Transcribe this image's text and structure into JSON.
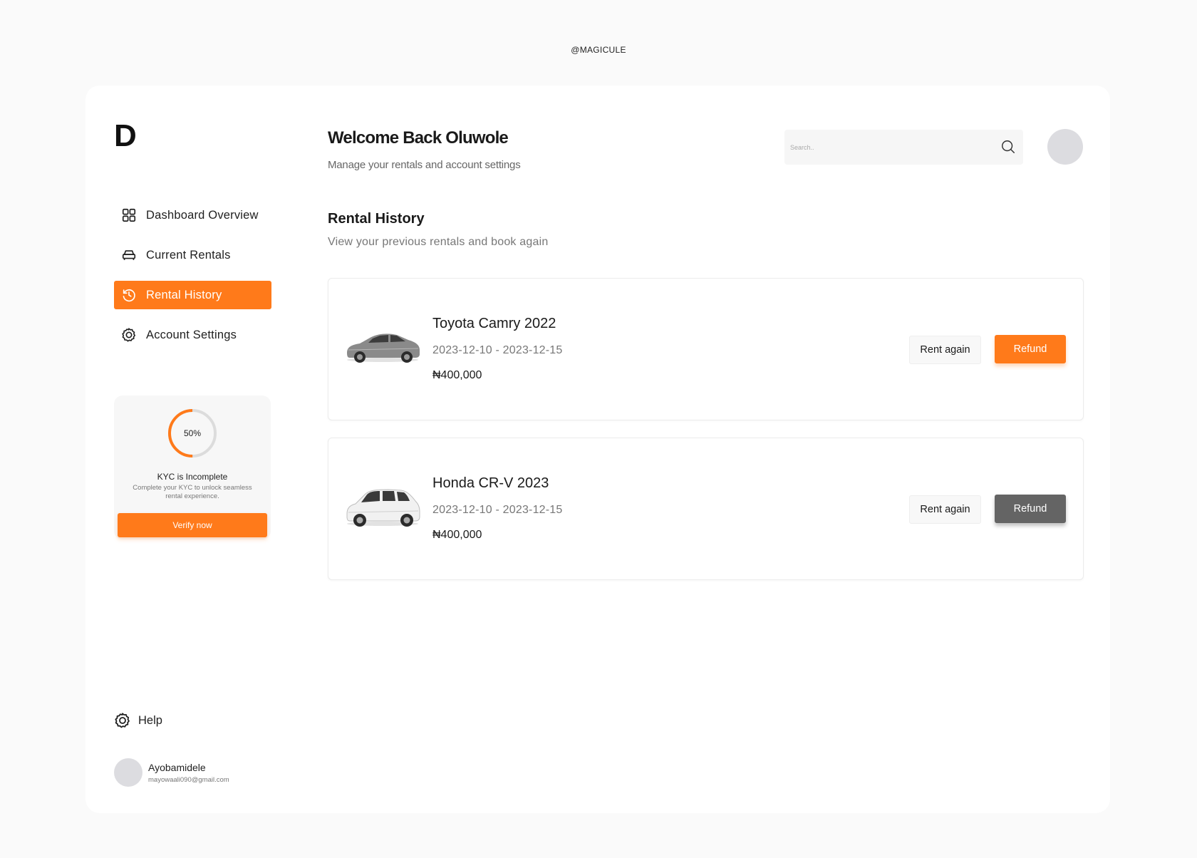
{
  "watermark": "@MAGICULE",
  "brand": {
    "logo": "D",
    "accent": "#ff7a1a"
  },
  "sidebar": {
    "items": [
      {
        "label": "Dashboard Overview",
        "icon": "grid-icon",
        "active": false
      },
      {
        "label": "Current Rentals",
        "icon": "car-icon",
        "active": false
      },
      {
        "label": "Rental History",
        "icon": "history-icon",
        "active": true
      },
      {
        "label": "Account Settings",
        "icon": "gear-icon",
        "active": false
      }
    ],
    "help_label": "Help"
  },
  "kyc": {
    "progress_percent": 50,
    "progress_label": "50%",
    "title": "KYC is Incomplete",
    "description": "Complete your KYC to unlock seamless rental experience.",
    "button_label": "Verify now"
  },
  "user": {
    "name": "Ayobamidele",
    "email": "mayowaali090@gmail.com"
  },
  "header": {
    "welcome": "Welcome Back Oluwole",
    "subtitle": "Manage your rentals and account settings",
    "search_placeholder": "Search.."
  },
  "section": {
    "title": "Rental History",
    "subtitle": "View your previous rentals and book again"
  },
  "rentals": [
    {
      "name": "Toyota Camry 2022",
      "dates": "2023-12-10 - 2023-12-15",
      "price": "₦400,000",
      "rent_again_label": "Rent again",
      "refund_label": "Refund",
      "refund_color": "#ff7a1a",
      "image": "sedan-car-image"
    },
    {
      "name": "Honda CR-V 2023",
      "dates": "2023-12-10 - 2023-12-15",
      "price": "₦400,000",
      "rent_again_label": "Rent again",
      "refund_label": "Refund",
      "refund_color": "#646464",
      "image": "suv-car-image"
    }
  ]
}
